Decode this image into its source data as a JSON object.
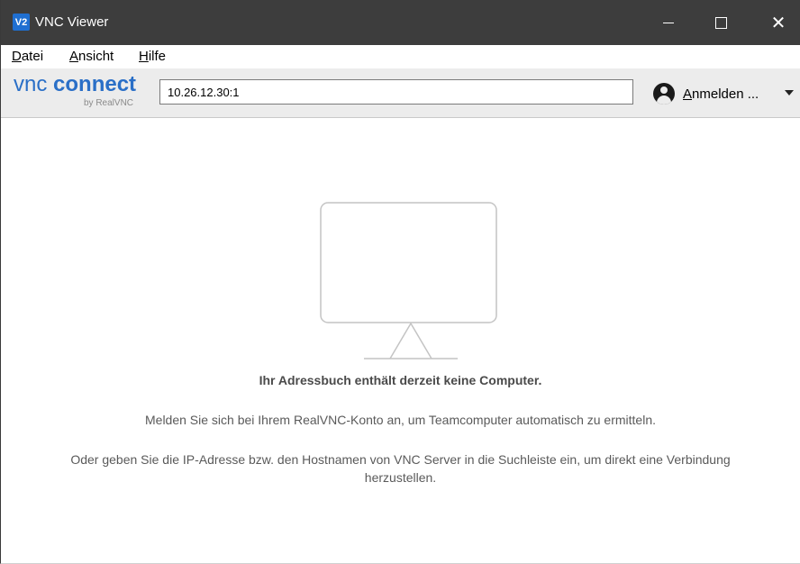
{
  "window": {
    "app_icon_text": "V2",
    "title": "VNC Viewer"
  },
  "menu": {
    "datei": {
      "mnemonic": "D",
      "rest": "atei"
    },
    "ansicht": {
      "mnemonic": "A",
      "rest": "nsicht"
    },
    "hilfe": {
      "mnemonic": "H",
      "rest": "ilfe"
    }
  },
  "toolbar": {
    "logo_vnc": "vnc",
    "logo_connect": "connect",
    "logo_sub": "by RealVNC",
    "address_value": "10.26.12.30:1",
    "signin": {
      "mnemonic": "A",
      "rest": "nmelden ..."
    }
  },
  "main": {
    "empty_title": "Ihr Adressbuch enthält derzeit keine Computer.",
    "line1": "Melden Sie sich bei Ihrem RealVNC-Konto an, um Teamcomputer automatisch zu ermitteln.",
    "line2": "Oder geben Sie die IP-Adresse bzw. den Hostnamen von VNC Server in die Suchleiste ein, um direkt eine Verbindung herzustellen."
  },
  "colors": {
    "titlebar": "#3d3d3d",
    "toolbar": "#ececec",
    "brand_blue": "#2a6fc7"
  },
  "icons": {
    "app": "vnc-viewer-app-icon",
    "minimize": "minimize-icon",
    "maximize": "maximize-icon",
    "close": "close-icon",
    "avatar": "user-avatar-icon",
    "dropdown": "chevron-down-icon",
    "monitor": "monitor-icon"
  }
}
